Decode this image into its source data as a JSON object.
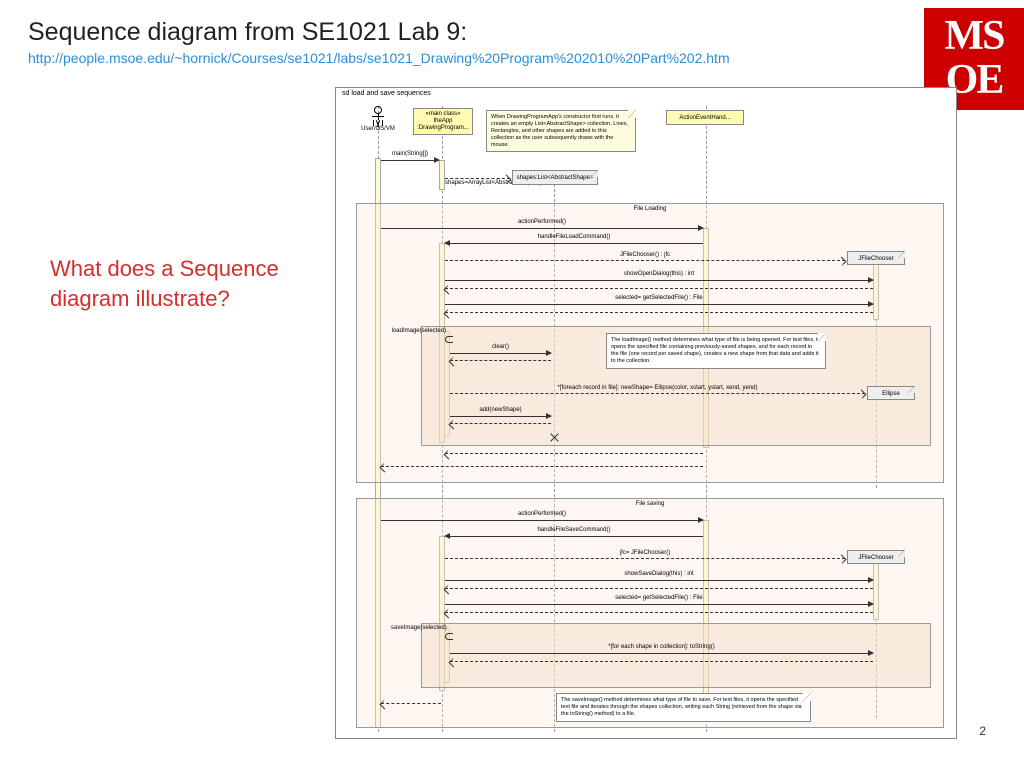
{
  "title": "Sequence diagram from SE1021 Lab 9:",
  "url": "http://people.msoe.edu/~hornick/Courses/se1021/labs/se1021_Drawing%20Program%202010%20Part%202.htm",
  "question": "What does a Sequence diagram illustrate?",
  "page_number": "2",
  "logo": {
    "top": "MS",
    "bottom": "OE"
  },
  "diagram": {
    "tab": "sd load and save sequences",
    "actor": "User/OS/VM",
    "participants": {
      "theApp": {
        "stereo": "«main class»",
        "name": "theApp",
        "cls": ":DrawingProgram..."
      },
      "handler": "ActionEventHand..."
    },
    "note_top": "When DrawingProgramApp's constructor first runs, it creates an empty List<AbstractShape> collection. Lines, Rectangles, and other shapes are added to this collection as the user subsequently draws with the mouse.",
    "created": {
      "shapes_list": "shapes=ArrayList<AbstractShape>()",
      "shapes_obj": "shapes:List<AbstractShape>",
      "jfc1": "JFileChooser",
      "jfc2": "JFileChooser",
      "ellipse": "Ellipse"
    },
    "frames": {
      "load": "File Loading",
      "save": "File saving"
    },
    "messages": {
      "main": "main(String[])",
      "m1": "actionPerformed()",
      "m2": "handleFileLoadCommand()",
      "m3": "JFileChooser() : jfc",
      "m4": "showOpenDialog(this) : int",
      "m5": "selected= getSelectedFile() : File",
      "m6": "loadImage(selected)",
      "m7": "clear()",
      "m8": "*[foreach record in file]: newShape= Ellipse(color, xstart, ystart, xend, yend)",
      "m9": "add(newShape)",
      "s1": "actionPerformed()",
      "s2": "handleFileSaveCommand()",
      "s3": "jfc= JFileChooser()",
      "s4": "showSaveDialog(this) : int",
      "s5": "selected= getSelectedFile() : File",
      "s6": "saveImage(selected)",
      "s7": "*[for each shape in collection]: toString()"
    },
    "note_load": "The loadImage() method determines what type of file is being opened. For text files, it opens the specified file containing previously-saved shapes, and for each record in the file (one record per saved shape), creates a new shape from that data and adds it to the collection.",
    "note_save": "The saveImage() method determines what type of file to save. For text files, it opens the specified text file and iterates through the shapes collection, writing each String (retrieved from the shape via the toString() method) to a file."
  }
}
